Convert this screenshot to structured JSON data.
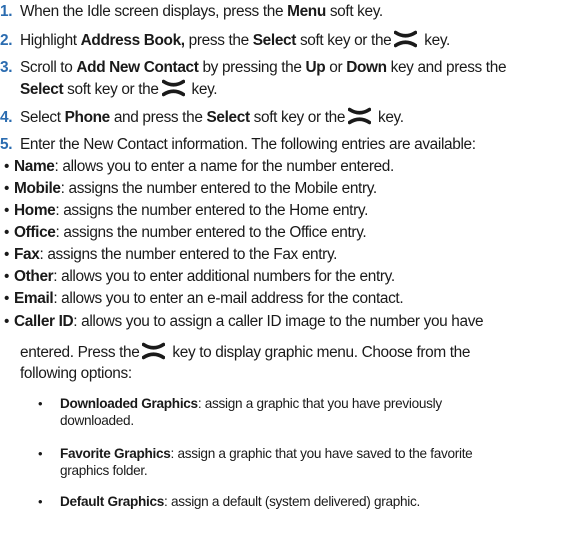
{
  "steps": [
    {
      "num": "1.",
      "pre": "When the Idle screen displays, press the ",
      "b1": "Menu",
      "post": " soft key."
    },
    {
      "num": "2.",
      "pre": "Highlight ",
      "b1": "Address Book,",
      "mid": " press the ",
      "b2": "Select",
      "post": " soft key or the",
      "post2": " key."
    },
    {
      "num": "3.",
      "pre": "Scroll to ",
      "b1": "Add New Contact",
      "mid": " by pressing the ",
      "b2": "Up",
      "mid2": " or ",
      "b3": "Down",
      "post": " key and press the",
      "l2_b": "Select",
      "l2_post": " soft key or the",
      "l2_post2": " key."
    },
    {
      "num": "4.",
      "pre": "Select ",
      "b1": "Phone",
      "mid": " and press the ",
      "b2": "Select",
      "post": " soft key or the",
      "post2": " key."
    },
    {
      "num": "5.",
      "pre": "Enter the New Contact information. The following entries are available:"
    }
  ],
  "entries": [
    {
      "label": "Name",
      "text": ": allows you to enter a name for the number entered."
    },
    {
      "label": "Mobile",
      "text": ": assigns the number entered to the Mobile entry."
    },
    {
      "label": "Home",
      "text": ": assigns the number entered to the Home entry."
    },
    {
      "label": "Office",
      "text": ": assigns the number entered to the Office entry."
    },
    {
      "label": "Fax",
      "text": ": assigns the number entered to the Fax entry."
    },
    {
      "label": "Other",
      "text": ": allows you to enter additional numbers for the entry."
    },
    {
      "label": "Email",
      "text": ": allows you to enter an e-mail address for the contact."
    },
    {
      "label": "Caller ID",
      "text": ": allows you to assign a caller ID image to the number you have"
    }
  ],
  "caller_id": {
    "cont1_pre": "entered. Press the",
    "cont1_post": " key to display graphic menu. Choose from the",
    "cont2": "following options:"
  },
  "options": [
    {
      "label": "Downloaded Graphics",
      "text": ": assign a graphic that you have previously",
      "cont": "downloaded."
    },
    {
      "label": "Favorite Graphics",
      "text": ": assign a graphic that you have saved to the favorite",
      "cont": "graphics folder."
    },
    {
      "label": "Default Graphics",
      "text": ": assign a default (system delivered) graphic."
    }
  ],
  "bullet_char": "•",
  "icon": "ok-x-key-icon"
}
